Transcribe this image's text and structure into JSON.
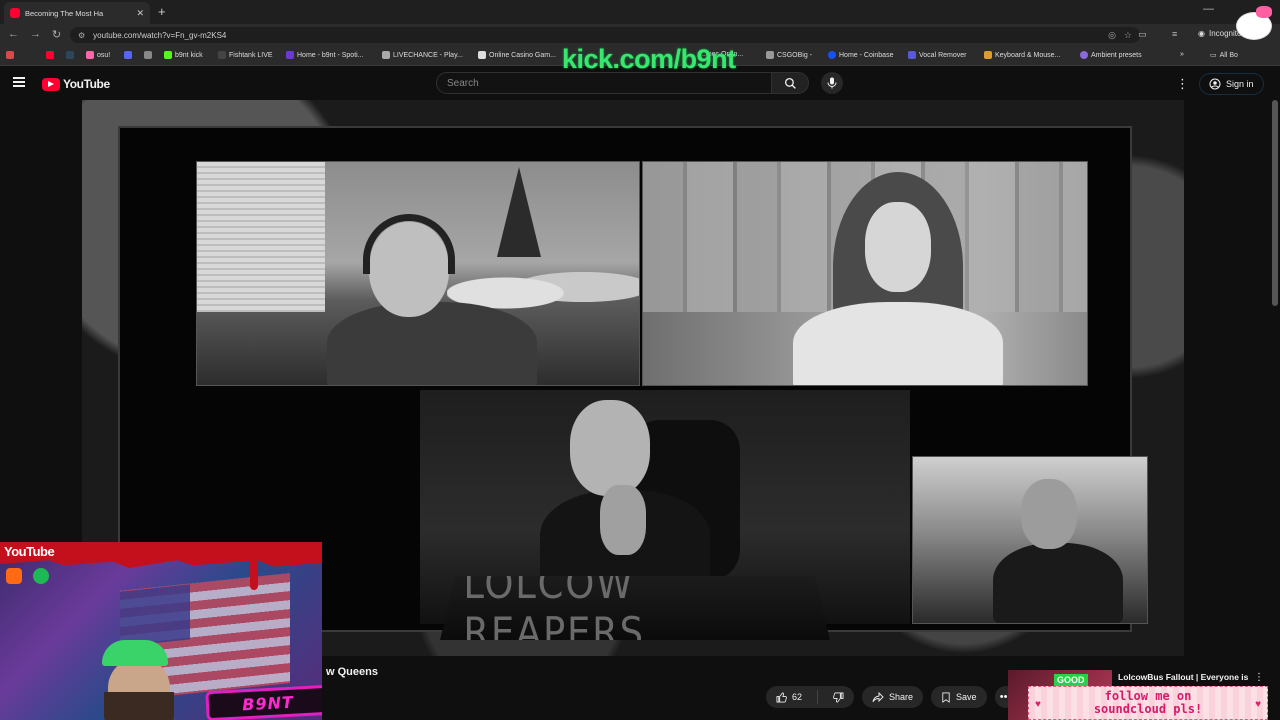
{
  "browser": {
    "tab_title": "Becoming The Most Ha",
    "url": "youtube.com/watch?v=Fn_gv-m2KS4",
    "incognito_label": "Incognito",
    "bookmarks": [
      "osu!",
      "b9nt kick",
      "Fishtank LIVE",
      "Home - b9nt - Spoti...",
      "LIVECHANCE - Play...",
      "Online Casino Gam...",
      "...mes Onlin...",
      "CSGOBig -",
      "Home - Coinbase",
      "Vocal Remover",
      "Keyboard & Mouse...",
      "Ambient presets"
    ],
    "all_bookmarks_label": "All Bo"
  },
  "overlay": {
    "kick_url": "kick.com/b9nt",
    "webcam_brand": "YouTube",
    "streamer_tag": "B9NT",
    "soundcloud_line1": "follow me on",
    "soundcloud_line2": "soundcloud pls!"
  },
  "youtube": {
    "logo_text": "YouTube",
    "search_placeholder": "Search",
    "signin_label": "Sign in"
  },
  "video": {
    "banner_text": "LOLCOW REAPERS",
    "title_fragment": "w Queens",
    "like_count": "62",
    "share_label": "Share",
    "save_label": "Save"
  },
  "recommendation": {
    "badge": "GOOD",
    "title": "LolcowBus Fallout | Everyone is"
  },
  "colors": {
    "youtube_red": "#ff0033",
    "kick_green": "#39e66e",
    "bg": "#0f0f0f"
  }
}
